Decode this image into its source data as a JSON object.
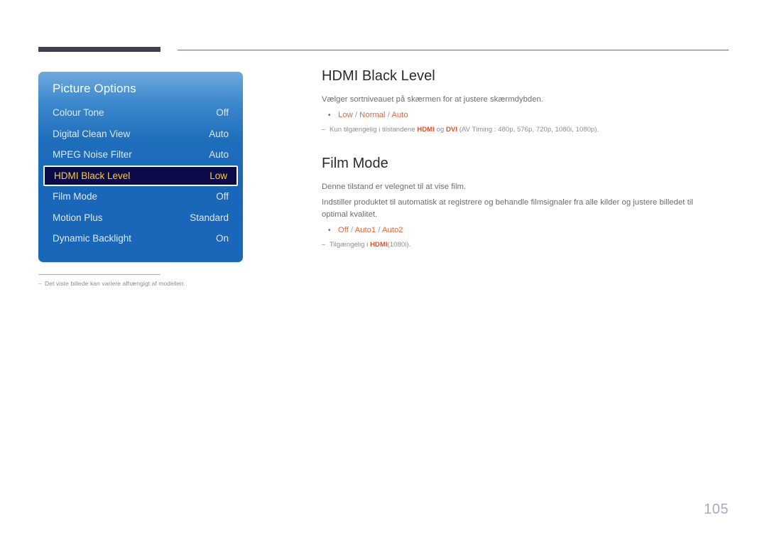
{
  "page": {
    "number": "105"
  },
  "osd": {
    "title": "Picture Options",
    "items": [
      {
        "label": "Colour Tone",
        "value": "Off",
        "selected": false
      },
      {
        "label": "Digital Clean View",
        "value": "Auto",
        "selected": false
      },
      {
        "label": "MPEG Noise Filter",
        "value": "Auto",
        "selected": false
      },
      {
        "label": "HDMI Black Level",
        "value": "Low",
        "selected": true
      },
      {
        "label": "Film Mode",
        "value": "Off",
        "selected": false
      },
      {
        "label": "Motion Plus",
        "value": "Standard",
        "selected": false
      },
      {
        "label": "Dynamic Backlight",
        "value": "On",
        "selected": false
      }
    ],
    "footnote_dash": "–",
    "footnote": "Det viste billede kan variere afhængigt af modellen."
  },
  "sections": {
    "hdmi_black_level": {
      "title": "HDMI Black Level",
      "description": "Vælger sortniveauet på skærmen for at justere skærmdybden.",
      "bullet_dot": "•",
      "options": {
        "first": "Low",
        "sep1": " / ",
        "second": "Normal",
        "sep2": " / ",
        "third": "Auto"
      },
      "note": {
        "dash": "⎯",
        "part1": "Kun tilgængelig i tilstandene ",
        "hl1": "HDMI",
        "part2": " og ",
        "hl2": "DVI",
        "part3": " (AV Timing : 480p, 576p, 720p, 1080i, 1080p)."
      }
    },
    "film_mode": {
      "title": "Film Mode",
      "description1": "Denne tilstand er velegnet til at vise film.",
      "description2": "Indstiller produktet til automatisk at registrere og behandle filmsignaler fra alle kilder og justere billedet til optimal kvalitet.",
      "bullet_dot": "•",
      "options": {
        "first": "Off",
        "sep1": " / ",
        "second": "Auto1",
        "sep2": " / ",
        "third": "Auto2"
      },
      "note": {
        "dash": "⎯",
        "part1": "Tilgængelig i ",
        "hl1": "HDMI",
        "part2": "(1080i)."
      }
    }
  },
  "colors": {
    "osd_blue": "#1a66b8",
    "osd_selected_bg": "#0b0b4a",
    "osd_selected_text": "#ffcc33",
    "accent_orange": "#e8643c",
    "accent_red": "#e0512e",
    "header_bar": "#43414f",
    "page_number": "#a8aabe"
  }
}
